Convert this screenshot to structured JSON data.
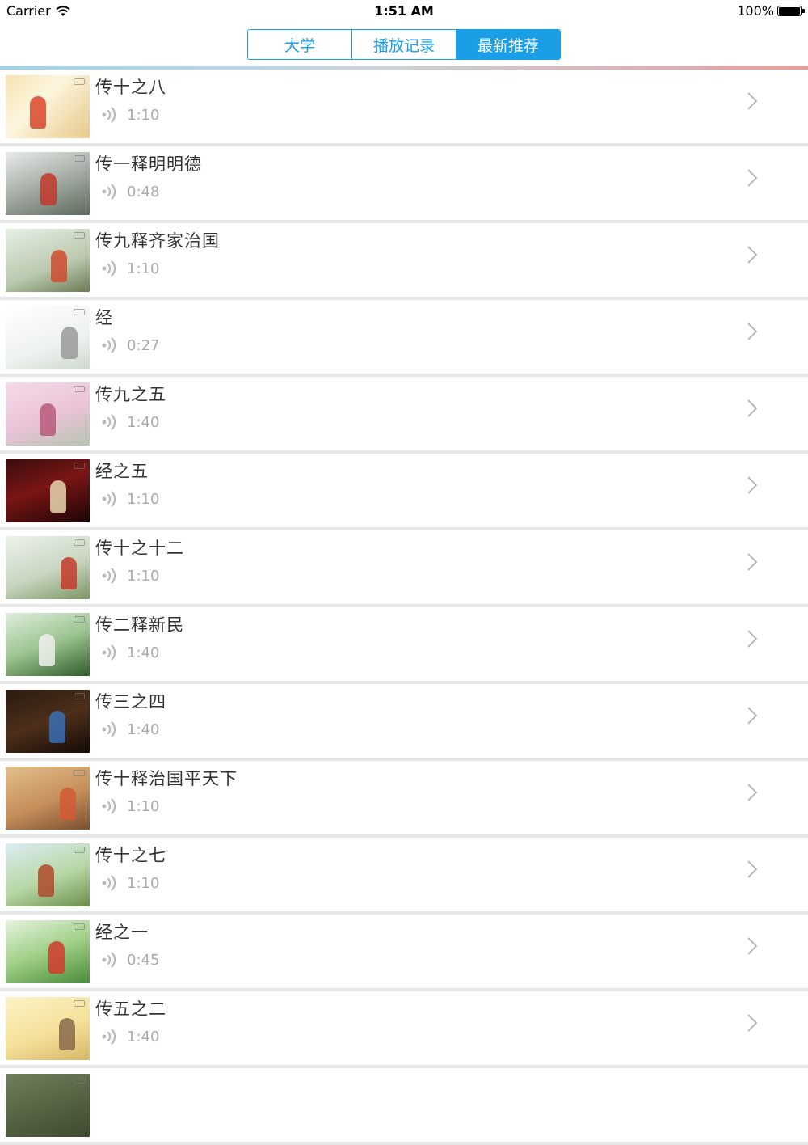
{
  "status_bar": {
    "carrier": "Carrier",
    "time": "1:51 AM",
    "battery": "100%"
  },
  "tabs": [
    {
      "label": "大学",
      "active": false
    },
    {
      "label": "播放记录",
      "active": false
    },
    {
      "label": "最新推荐",
      "active": true
    }
  ],
  "colors": {
    "accent": "#1a9ee6",
    "separator": "#e7e7e7",
    "duration_text": "#aaaaaa"
  },
  "items": [
    {
      "title": "传十之八",
      "duration": "1:10"
    },
    {
      "title": "传一释明明德",
      "duration": "0:48"
    },
    {
      "title": "传九释齐家治国",
      "duration": "1:10"
    },
    {
      "title": "经",
      "duration": "0:27"
    },
    {
      "title": "传九之五",
      "duration": "1:40"
    },
    {
      "title": "经之五",
      "duration": "1:10"
    },
    {
      "title": "传十之十二",
      "duration": "1:10"
    },
    {
      "title": "传二释新民",
      "duration": "1:40"
    },
    {
      "title": "传三之四",
      "duration": "1:40"
    },
    {
      "title": "传十释治国平天下",
      "duration": "1:10"
    },
    {
      "title": "传十之七",
      "duration": "1:10"
    },
    {
      "title": "经之一",
      "duration": "0:45"
    },
    {
      "title": "传五之二",
      "duration": "1:40"
    }
  ]
}
